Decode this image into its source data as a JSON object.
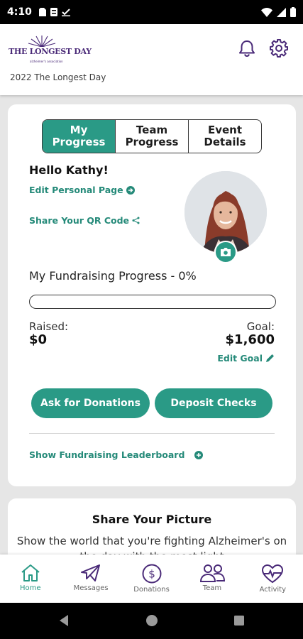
{
  "status_bar": {
    "time": "4:10"
  },
  "header": {
    "logo_text": "THE LONGEST DAY",
    "logo_subtext": "alzheimer's association",
    "subtitle": "2022 The Longest Day"
  },
  "tabs": [
    {
      "label": "My Progress",
      "active": true
    },
    {
      "label": "Team Progress",
      "active": false
    },
    {
      "label": "Event Details",
      "active": false
    }
  ],
  "profile": {
    "greeting": "Hello Kathy!",
    "edit_page_link": "Edit Personal Page",
    "share_qr_link": "Share Your QR Code"
  },
  "fundraising": {
    "title": "My Fundraising Progress - 0%",
    "progress_percent": 0,
    "raised_label": "Raised:",
    "raised_value": "$0",
    "goal_label": "Goal:",
    "goal_value": "$1,600",
    "edit_goal_link": "Edit Goal"
  },
  "actions": {
    "ask_donations": "Ask for Donations",
    "deposit_checks": "Deposit Checks"
  },
  "leaderboard_link": "Show Fundraising Leaderboard",
  "share_picture": {
    "title": "Share Your Picture",
    "description": "Show the world that you're fighting Alzheimer's on the day with the most light"
  },
  "bottom_nav": [
    {
      "label": "Home",
      "icon": "home-icon",
      "active": true
    },
    {
      "label": "Messages",
      "icon": "paper-plane-icon",
      "active": false
    },
    {
      "label": "Donations",
      "icon": "dollar-circle-icon",
      "active": false
    },
    {
      "label": "Team",
      "icon": "team-icon",
      "active": false
    },
    {
      "label": "Activity",
      "icon": "heart-pulse-icon",
      "active": false
    }
  ],
  "colors": {
    "accent": "#2a9a86",
    "brand_purple": "#4a2a78",
    "nav_active": "#2a9a86"
  }
}
